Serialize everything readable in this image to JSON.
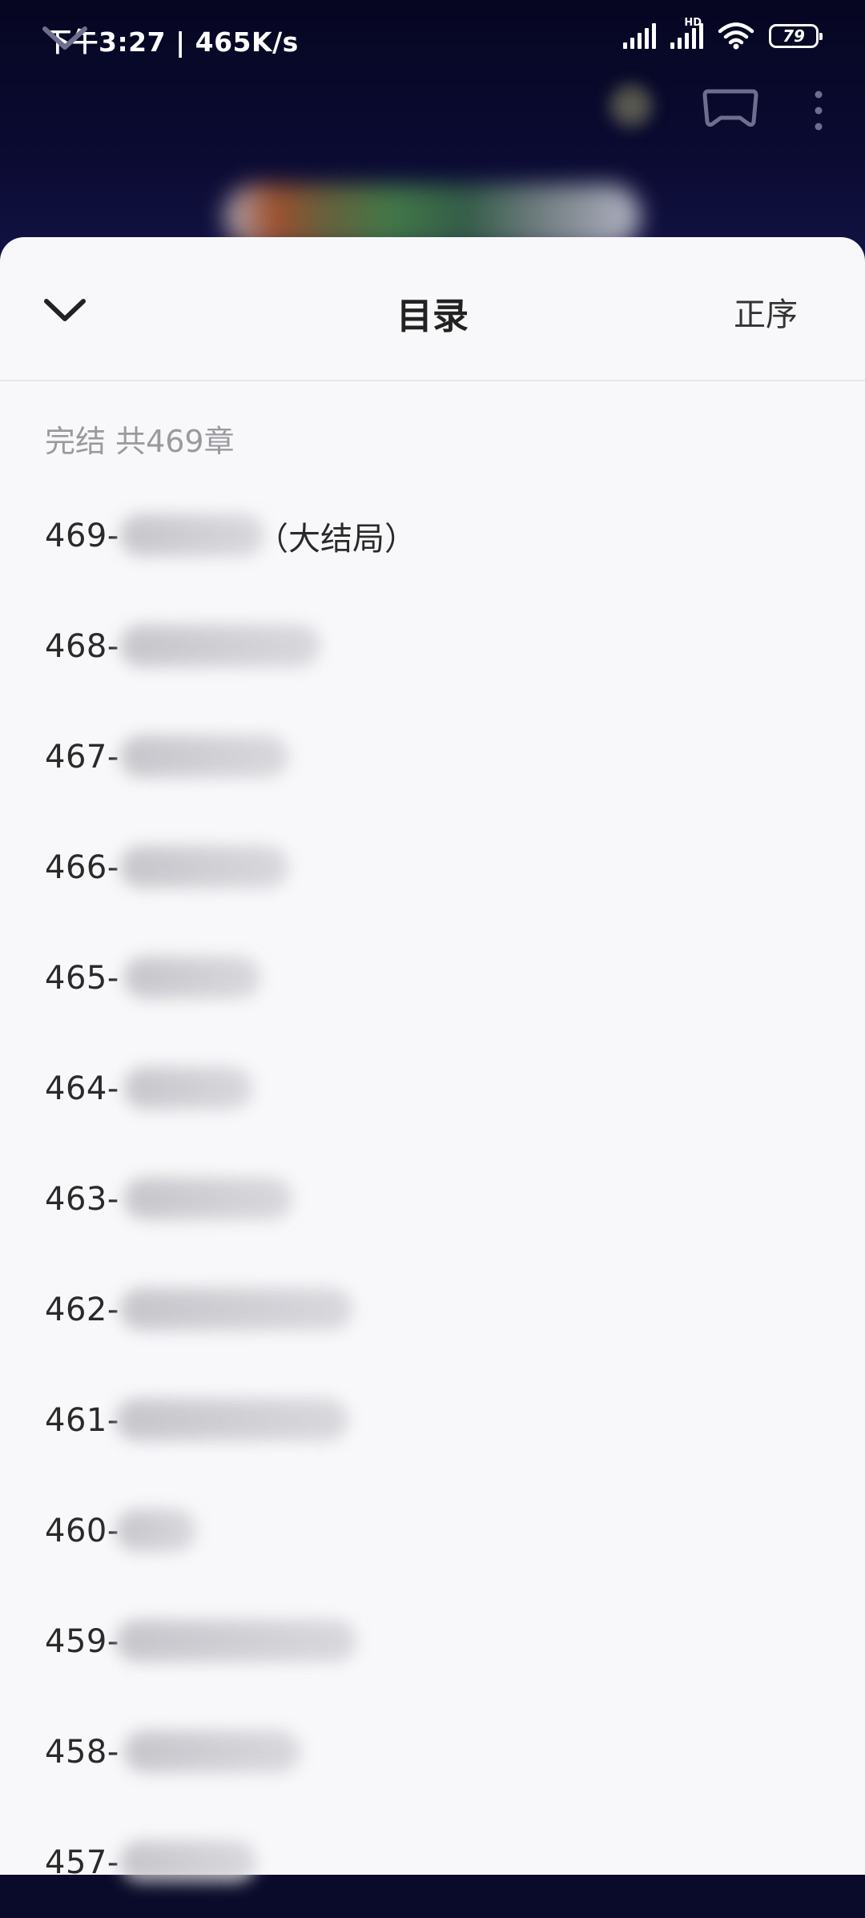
{
  "status_bar": {
    "time_speed": "下午3:27 | 465K/s",
    "network_badge": "HD",
    "battery": "79"
  },
  "toolbar": {
    "collapse_icon": "chevron-down-icon",
    "game_icon": "gamepad-icon",
    "more_icon": "more-vertical-icon"
  },
  "sheet": {
    "close_icon": "chevron-down-icon",
    "title": "目录",
    "order_label": "正序",
    "summary": "完结 共469章"
  },
  "chapters": [
    {
      "number": "469-",
      "suffix": "（大结局）"
    },
    {
      "number": "468-",
      "suffix": ""
    },
    {
      "number": "467-",
      "suffix": ""
    },
    {
      "number": "466-",
      "suffix": ""
    },
    {
      "number": "465-",
      "suffix": ""
    },
    {
      "number": "464-",
      "suffix": ""
    },
    {
      "number": "463-",
      "suffix": ""
    },
    {
      "number": "462-",
      "suffix": ""
    },
    {
      "number": "461-",
      "suffix": ""
    },
    {
      "number": "460-",
      "suffix": ""
    },
    {
      "number": "459-",
      "suffix": ""
    },
    {
      "number": "458-",
      "suffix": ""
    },
    {
      "number": "457-",
      "suffix": ""
    }
  ]
}
